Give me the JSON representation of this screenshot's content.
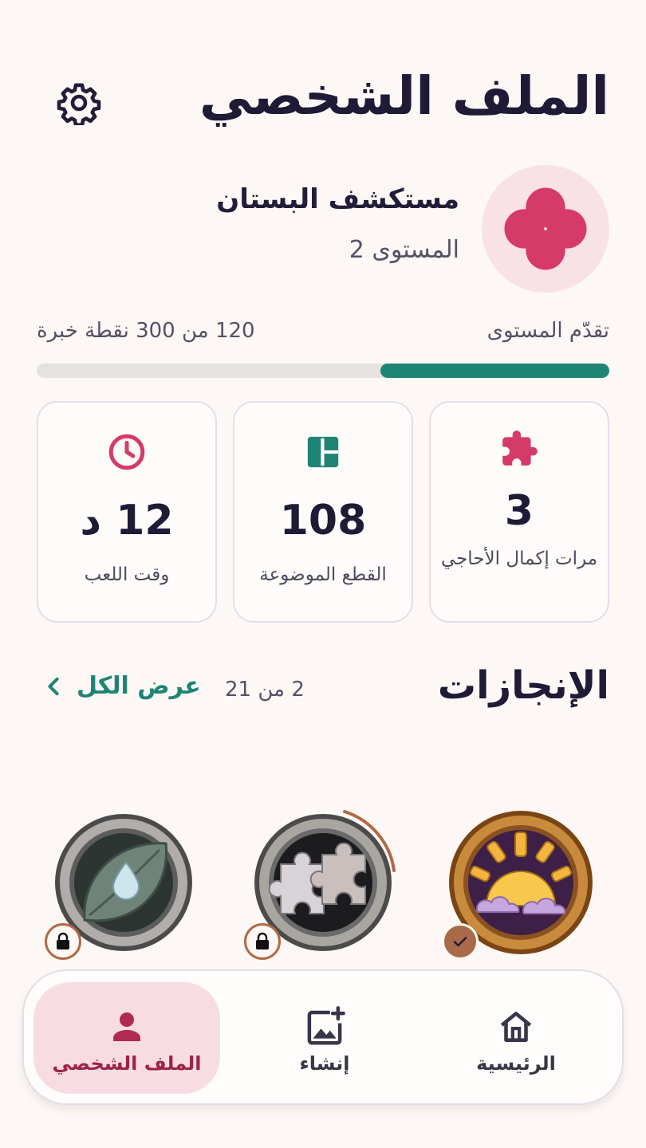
{
  "header": {
    "title": "الملف الشخصي",
    "settings_icon": "gear-icon"
  },
  "profile": {
    "name": "مستكشف البستان",
    "level": "المستوى 2",
    "avatar_icon": "flower-icon",
    "avatar_color": "#d63a68"
  },
  "progress": {
    "label": "تقدّم المستوى",
    "value_text": "120 من 300 نقطة خبرة",
    "current": 120,
    "max": 300,
    "fill_color": "#1e8474"
  },
  "stats": [
    {
      "icon": "puzzle-piece-icon",
      "value": "3",
      "label": "مرات إكمال الأحاجي"
    },
    {
      "icon": "layout-grid-icon",
      "value": "108",
      "label": "القطع الموضوعة"
    },
    {
      "icon": "clock-icon",
      "value": "12 د",
      "label": "وقت اللعب"
    }
  ],
  "achievements": {
    "title": "الإنجازات",
    "count": "2 من 21",
    "view_all": "عرض الكل",
    "items": [
      {
        "name": "sunrise-medal",
        "status": "unlocked"
      },
      {
        "name": "puzzle-medal",
        "status": "locked"
      },
      {
        "name": "leaf-drop-medal",
        "status": "locked"
      }
    ]
  },
  "nav": {
    "home": "الرئيسية",
    "create": "إنشاء",
    "profile": "الملف الشخصي",
    "active": "profile"
  },
  "colors": {
    "background": "#fdf8f5",
    "accent_green": "#1e8474",
    "accent_pink": "#d63a68",
    "text_dark": "#1f1a36"
  }
}
